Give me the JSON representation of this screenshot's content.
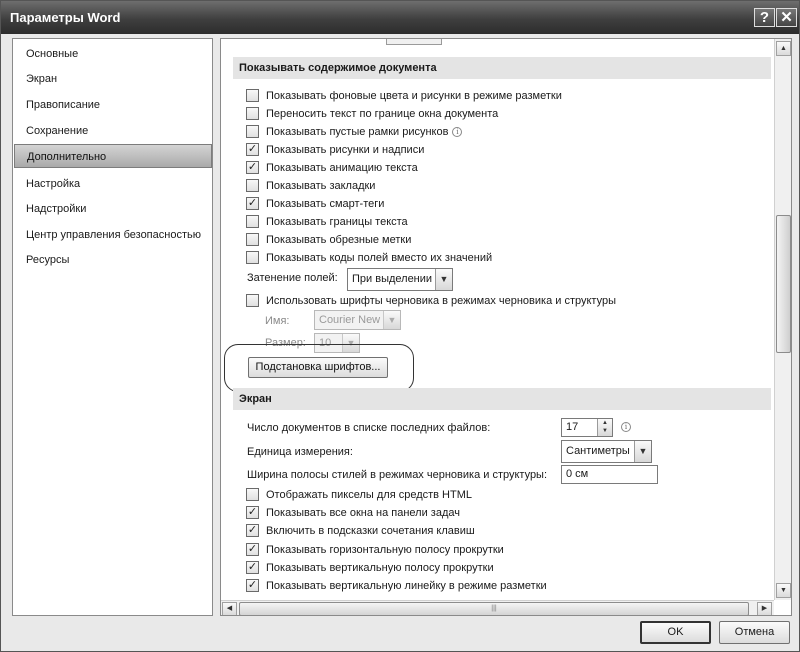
{
  "window": {
    "title": "Параметры Word",
    "help_glyph": "?",
    "close_glyph": "✕"
  },
  "nav": {
    "items": [
      {
        "label": "Основные"
      },
      {
        "label": "Экран"
      },
      {
        "label": "Правописание"
      },
      {
        "label": "Сохранение"
      },
      {
        "label": "Дополнительно",
        "selected": true
      },
      {
        "label": "Настройка"
      },
      {
        "label": "Надстройки"
      },
      {
        "label": "Центр управления безопасностью"
      },
      {
        "label": "Ресурсы"
      }
    ]
  },
  "doc_section": {
    "title": "Показывать содержимое документа",
    "checks": [
      {
        "label": "Показывать фоновые цвета и рисунки в режиме разметки",
        "checked": false
      },
      {
        "label": "Переносить текст по границе окна документа",
        "checked": false
      },
      {
        "label": "Показывать пустые рамки рисунков",
        "checked": false
      },
      {
        "label": "Показывать рисунки и надписи",
        "checked": true
      },
      {
        "label": "Показывать анимацию текста",
        "checked": true
      },
      {
        "label": "Показывать закладки",
        "checked": false
      },
      {
        "label": "Показывать смарт-теги",
        "checked": true
      },
      {
        "label": "Показывать границы текста",
        "checked": false
      },
      {
        "label": "Показывать обрезные метки",
        "checked": false
      },
      {
        "label": "Показывать коды полей вместо их значений",
        "checked": false
      }
    ],
    "field_shading_label": "Затенение полей:",
    "field_shading_value": "При выделении",
    "draft_font_label": "Использовать шрифты черновика в режимах черновика и структуры",
    "draft_font_checked": false,
    "name_label": "Имя:",
    "name_value": "Courier New",
    "size_label": "Размер:",
    "size_value": "10",
    "substitution_button": "Подстановка шрифтов..."
  },
  "display_section": {
    "title": "Экран",
    "recent_label": "Число документов в списке последних файлов:",
    "recent_value": "17",
    "units_label": "Единица измерения:",
    "units_value": "Сантиметры",
    "style_width_label": "Ширина полосы стилей в режимах черновика и структуры:",
    "style_width_value": "0 см",
    "checks": [
      {
        "label": "Отображать пикселы для средств HTML",
        "checked": false
      },
      {
        "label": "Показывать все окна на панели задач",
        "checked": true
      },
      {
        "label": "Включить в подсказки сочетания клавиш",
        "checked": true
      },
      {
        "label": "Показывать горизонтальную полосу прокрутки",
        "checked": true
      },
      {
        "label": "Показывать вертикальную полосу прокрутки",
        "checked": true
      },
      {
        "label": "Показывать вертикальную линейку в режиме разметки",
        "checked": true
      }
    ]
  },
  "footer": {
    "ok_label": "OK",
    "cancel_label": "Отмена"
  },
  "glyphs": {
    "check": "✓",
    "down_arrow": "▼",
    "up_arrow": "▲",
    "left_arrow": "◀",
    "right_arrow": "▶",
    "info": "i",
    "grip": "|||"
  },
  "icons": [
    "help-icon",
    "close-icon",
    "info-icon",
    "dropdown-arrow-icon",
    "spin-up-icon",
    "spin-down-icon",
    "scroll-up-arrow-icon",
    "scroll-down-arrow-icon",
    "scroll-left-arrow-icon",
    "scroll-right-arrow-icon"
  ],
  "colors": {
    "titlebar": "#3f3f3f",
    "nav_selected": "#a9a9a9",
    "section_header": "#e4e4e4"
  }
}
